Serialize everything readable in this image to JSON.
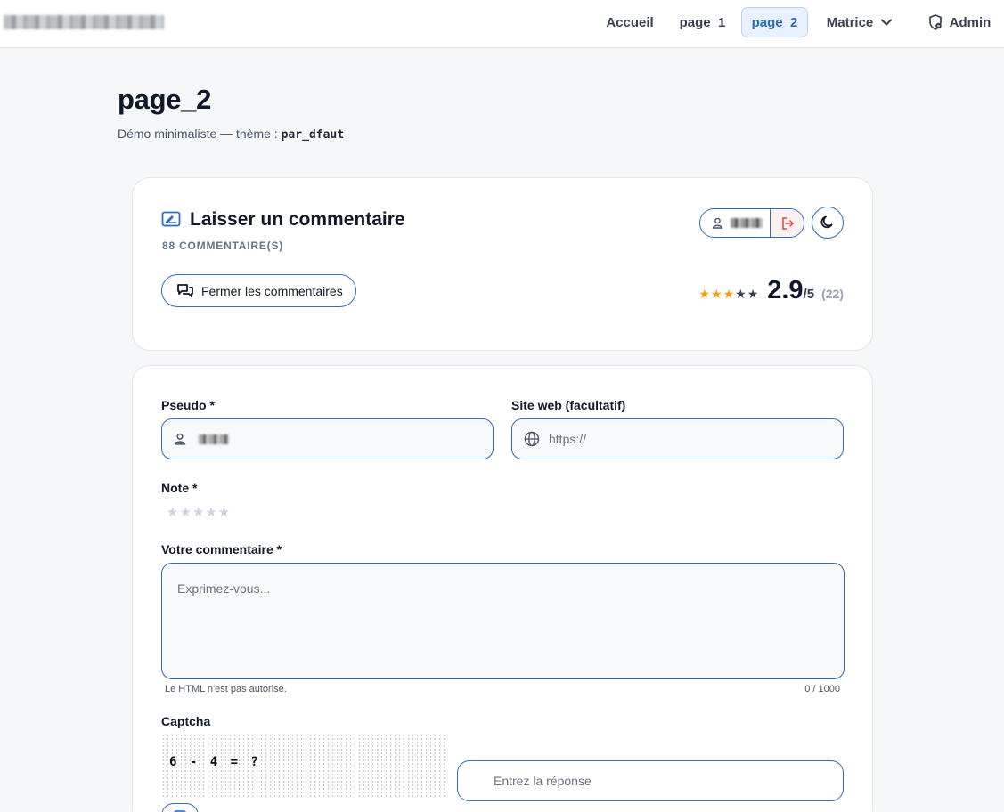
{
  "nav": {
    "items": [
      "Accueil",
      "page_1",
      "page_2",
      "Matrice"
    ],
    "active": "page_2",
    "admin": "Admin"
  },
  "page": {
    "title": "page_2",
    "subtitle": "Démo minimaliste — thème :",
    "theme": "par_dfaut"
  },
  "comments": {
    "title": "Laisser un commentaire",
    "count": "88 COMMENTAIRE(S)",
    "close_label": "Fermer les commentaires",
    "rating": {
      "score": "2.9",
      "max": "/5",
      "votes": "(22)",
      "stars_filled": 3,
      "stars_total": 5
    }
  },
  "form": {
    "pseudo_label": "Pseudo *",
    "website_label": "Site web (facultatif)",
    "website_placeholder": "https://",
    "note_label": "Note *",
    "comment_label": "Votre commentaire *",
    "comment_placeholder": "Exprimez-vous...",
    "html_hint": "Le HTML n'est pas autorisé.",
    "char_count": "0 / 1000",
    "captcha_label": "Captcha",
    "captcha_text": "6 - 4 = ?",
    "captcha_placeholder": "Entrez la réponse"
  },
  "colors": {
    "accent": "#2f6fb6",
    "star": "#f59e0b",
    "logout": "#e04848"
  }
}
